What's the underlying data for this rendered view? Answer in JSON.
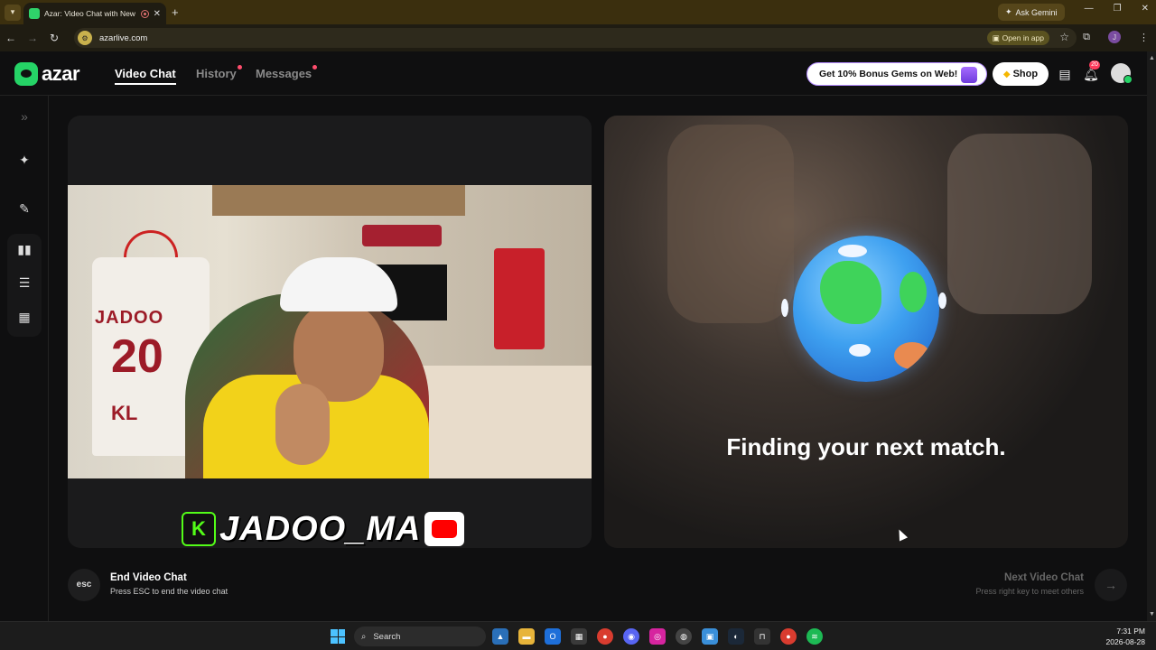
{
  "browser": {
    "tab_title": "Azar: Video Chat with New",
    "tab_close": "✕",
    "new_tab": "+",
    "ask_gemini": "Ask Gemini",
    "url": "azarlive.com",
    "open_in_app": "Open in app",
    "profile_initial": "J"
  },
  "app": {
    "logo_text": "azar",
    "nav": {
      "video_chat": "Video Chat",
      "history": "History",
      "messages": "Messages"
    },
    "promo": "Get 10% Bonus Gems on Web!",
    "shop": "Shop",
    "notification_count": "20",
    "esc_label": "esc",
    "end_title": "End Video Chat",
    "end_sub": "Press ESC to end the video chat",
    "next_title": "Next Video Chat",
    "next_sub": "Press right key to meet others",
    "matching_text": "Finding your next match.",
    "watermark_name": "JADOO_MA",
    "watermark_k": "K",
    "jersey": {
      "name": "JADOO",
      "number": "20",
      "sub": "KL"
    }
  },
  "icons": {
    "sidebar": [
      "expand-icon",
      "magic-wand-icon",
      "edit-icon",
      "layout-side-by-side-icon",
      "layout-stacked-icon",
      "layout-grid-icon"
    ],
    "top": [
      "gift-icon",
      "gem-icon",
      "inbox-icon",
      "bell-icon",
      "avatar"
    ]
  },
  "taskbar": {
    "search": "Search",
    "time": "7:31 PM",
    "date": "2026-08-28"
  },
  "colors": {
    "brand_green": "#25d366",
    "notification_red": "#ff3b5c",
    "background": "#0f0f10"
  }
}
